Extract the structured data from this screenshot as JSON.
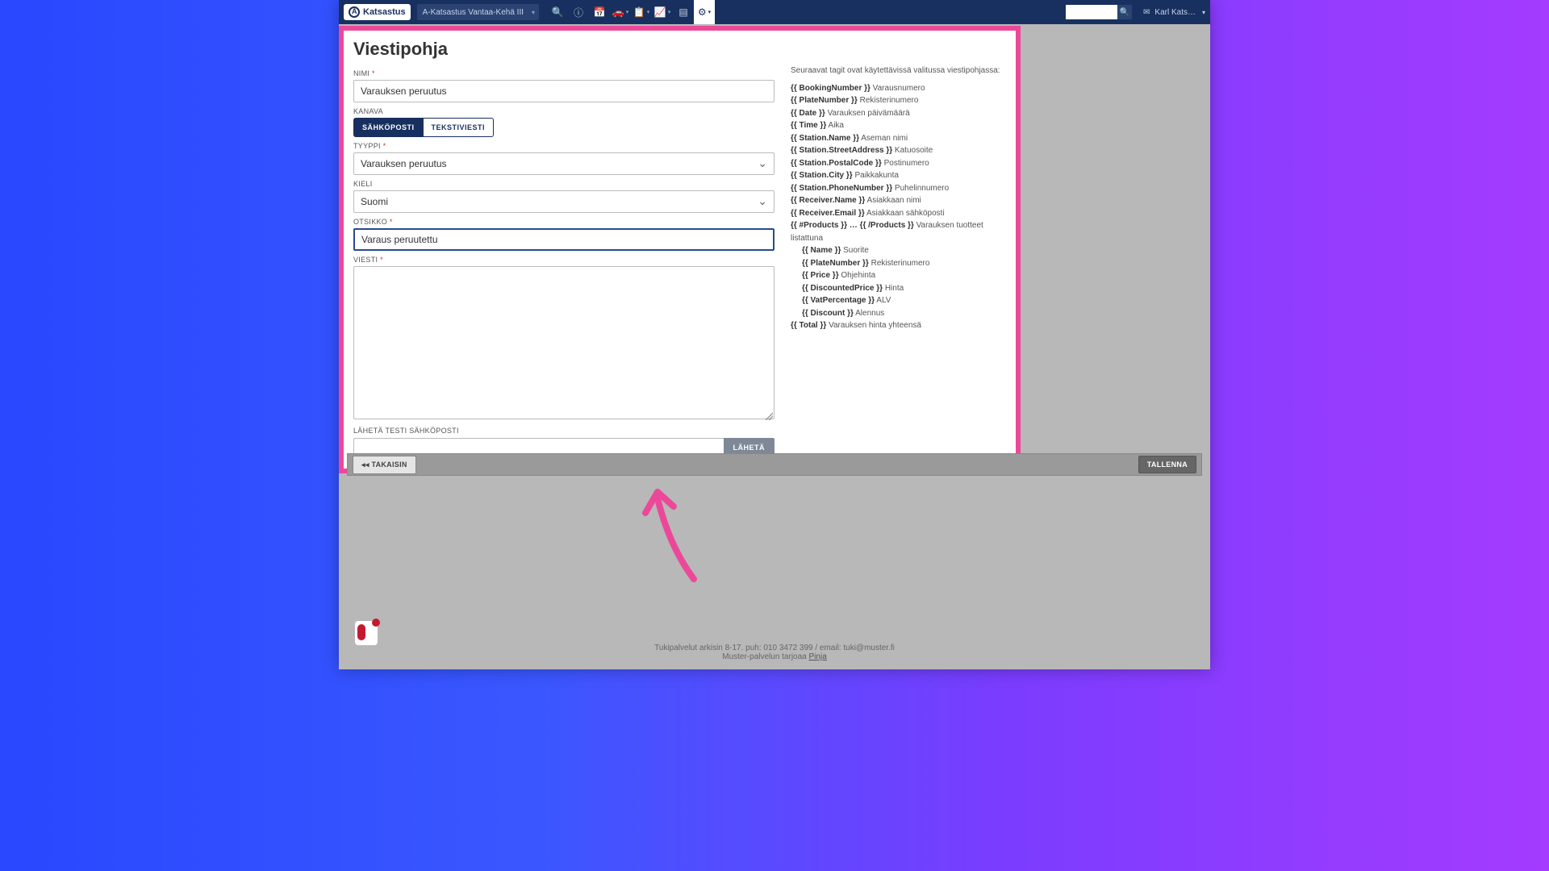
{
  "nav": {
    "logo_text": "Katsastus",
    "station": "A-Katsastus Vantaa-Kehä III",
    "search_placeholder": "",
    "user_name": "Karl Kats…"
  },
  "page": {
    "title": "Viestipohja"
  },
  "labels": {
    "nimi": "NIMI",
    "kanava": "KANAVA",
    "tyyppi": "TYYPPI",
    "kieli": "KIELI",
    "otsikko": "OTSIKKO",
    "viesti": "VIESTI",
    "send_test": "LÄHETÄ TESTI SÄHKÖPOSTI"
  },
  "form": {
    "nimi_value": "Varauksen peruutus",
    "kanava_email": "SÄHKÖPOSTI",
    "kanava_sms": "TEKSTIVIESTI",
    "tyyppi_value": "Varauksen peruutus",
    "kieli_value": "Suomi",
    "otsikko_value": "Varaus peruutettu",
    "viesti_value": "",
    "test_email_value": "",
    "send_btn": "LÄHETÄ"
  },
  "tags": {
    "intro": "Seuraavat tagit ovat käytettävissä valitussa viestipohjassa:",
    "list": [
      {
        "tag": "{{ BookingNumber }}",
        "desc": "Varausnumero"
      },
      {
        "tag": "{{ PlateNumber }}",
        "desc": "Rekisterinumero"
      },
      {
        "tag": "{{ Date }}",
        "desc": "Varauksen päivämäärä"
      },
      {
        "tag": "{{ Time }}",
        "desc": "Aika"
      },
      {
        "tag": "{{ Station.Name }}",
        "desc": "Aseman nimi"
      },
      {
        "tag": "{{ Station.StreetAddress }}",
        "desc": "Katuosoite"
      },
      {
        "tag": "{{ Station.PostalCode }}",
        "desc": "Postinumero"
      },
      {
        "tag": "{{ Station.City }}",
        "desc": "Paikkakunta"
      },
      {
        "tag": "{{ Station.PhoneNumber }}",
        "desc": "Puhelinnumero"
      },
      {
        "tag": "{{ Receiver.Name }}",
        "desc": "Asiakkaan nimi"
      },
      {
        "tag": "{{ Receiver.Email }}",
        "desc": "Asiakkaan sähköposti"
      },
      {
        "tag": "{{ #Products }} … {{ /Products }}",
        "desc": "Varauksen tuotteet listattuna"
      }
    ],
    "sublist": [
      {
        "tag": "{{ Name }}",
        "desc": "Suorite"
      },
      {
        "tag": "{{ PlateNumber }}",
        "desc": "Rekisterinumero"
      },
      {
        "tag": "{{ Price }}",
        "desc": "Ohjehinta"
      },
      {
        "tag": "{{ DiscountedPrice }}",
        "desc": "Hinta"
      },
      {
        "tag": "{{ VatPercentage }}",
        "desc": "ALV"
      },
      {
        "tag": "{{ Discount }}",
        "desc": "Alennus"
      }
    ],
    "total": {
      "tag": "{{ Total }}",
      "desc": "Varauksen hinta yhteensä"
    }
  },
  "actions": {
    "back": "TAKAISIN",
    "save": "TALLENNA"
  },
  "footer": {
    "line1": "Tukipalvelut arkisin 8-17. puh: 010 3472 399 / email: tuki@muster.fi",
    "line2_a": "Muster-palvelun tarjoaa ",
    "line2_b": "Pinja"
  }
}
